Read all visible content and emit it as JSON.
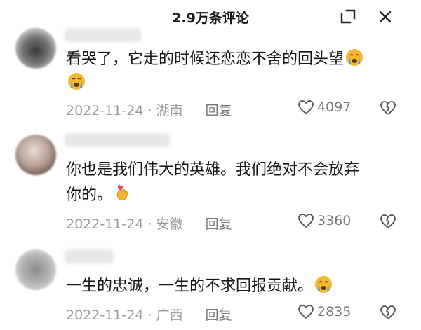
{
  "header": {
    "title": "2.9万条评论",
    "expand_icon": "expand-icon",
    "close_icon": "close-icon"
  },
  "comments": [
    {
      "text_line1": "看哭了，它走的时候还恋恋不舍的回头望",
      "text_line2": "",
      "date": "2022-11-24",
      "location": "湖南",
      "reply_label": "回复",
      "likes": "4097",
      "emoji_icon": "crying-face-icon"
    },
    {
      "text_line1": "你也是我们伟大的英雄。我们绝对不会放弃",
      "text_line2": "你的。",
      "date": "2022-11-24",
      "location": "安徽",
      "reply_label": "回复",
      "likes": "3360",
      "emoji_icon": "finger-heart-icon"
    },
    {
      "text_line1": "一生的忠诚，一生的不求回报贡献。",
      "text_line2": "",
      "date": "2022-11-24",
      "location": "广西",
      "reply_label": "回复",
      "likes": "2835",
      "emoji_icon": "crying-face-icon"
    }
  ],
  "separator": "·",
  "colors": {
    "text": "#161616",
    "meta": "#9a9a9a",
    "emoji": "#f5b82e",
    "tears": "#4aa3e8"
  }
}
